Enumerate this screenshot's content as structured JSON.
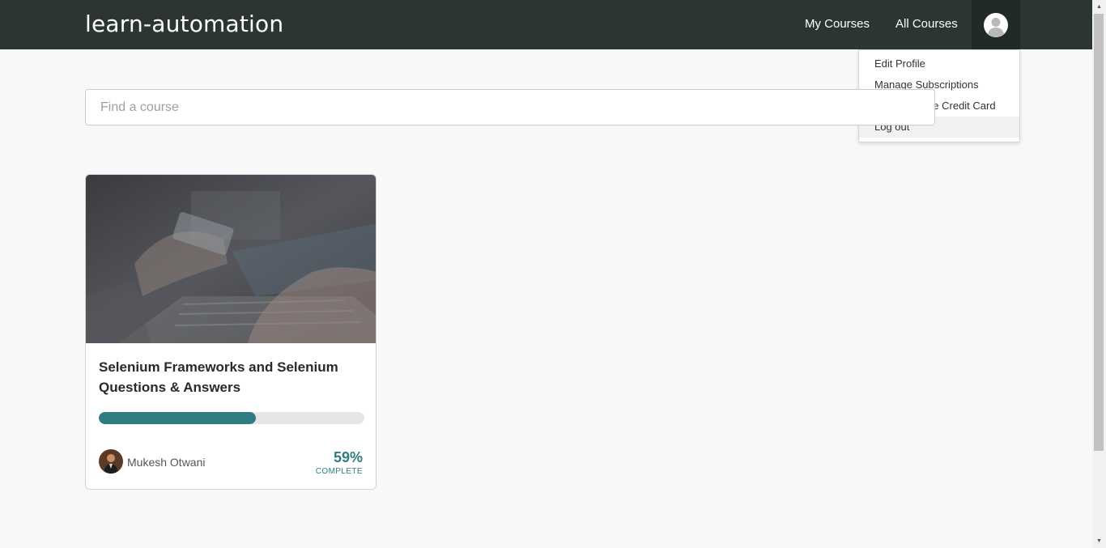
{
  "header": {
    "brand": "learn-automation",
    "nav": {
      "my_courses": "My Courses",
      "all_courses": "All Courses"
    }
  },
  "user_menu": {
    "items": [
      "Edit Profile",
      "Manage Subscriptions",
      "Add / Change Credit Card",
      "Log out"
    ],
    "highlighted_item": "Log out"
  },
  "search": {
    "placeholder": "Find a course",
    "value": ""
  },
  "courses": [
    {
      "title": "Selenium Frameworks and Selenium Questions & Answers",
      "author": "Mukesh Otwani",
      "progress_percent": 59,
      "progress_text": "59%",
      "progress_label": "COMPLETE"
    }
  ],
  "colors": {
    "navbar": "#2c3533",
    "accent": "#2f7d80",
    "background": "#f8f8f8"
  },
  "icons": {
    "user_avatar": "user-avatar-icon"
  }
}
